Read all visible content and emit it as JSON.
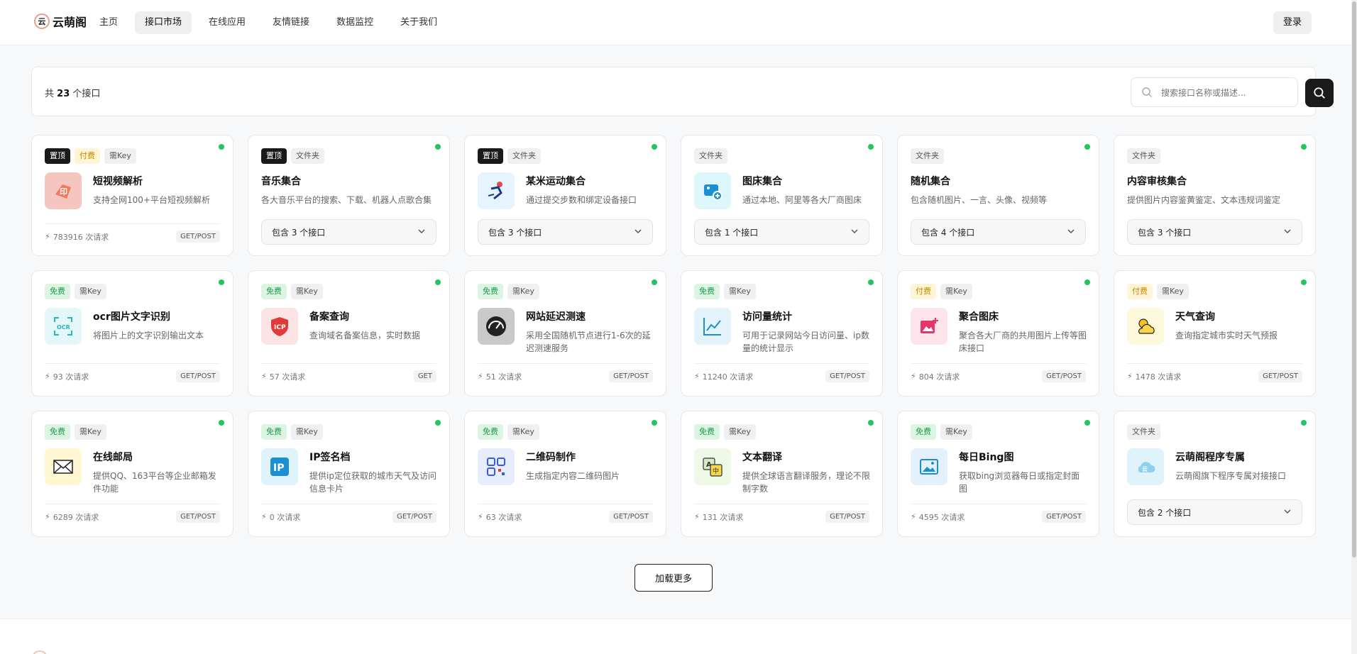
{
  "nav": {
    "logo_text": "云萌阁",
    "logo_sub": "",
    "menu": [
      {
        "label": "主页",
        "active": false
      },
      {
        "label": "接口市场",
        "active": true
      },
      {
        "label": "在线应用",
        "active": false
      },
      {
        "label": "友情链接",
        "active": false
      },
      {
        "label": "数据监控",
        "active": false
      },
      {
        "label": "关于我们",
        "active": false
      }
    ],
    "login_label": "登录"
  },
  "summary": {
    "prefix": "共",
    "count": "23",
    "suffix": "个接口",
    "search_placeholder": "搜索接口名称或描述..."
  },
  "cards": [
    {
      "tags": [
        {
          "text": "置顶",
          "type": "top"
        },
        {
          "text": "付费",
          "type": "paid"
        },
        {
          "text": "需Key",
          "type": "key"
        }
      ],
      "icon": "video-parse-icon",
      "title": "短视频解析",
      "desc": "支持全网100+平台短视频解析",
      "requests": "783916 次请求",
      "method": "GET/POST"
    },
    {
      "tags": [
        {
          "text": "置顶",
          "type": "top"
        },
        {
          "text": "文件夹",
          "type": "key"
        }
      ],
      "title": "音乐集合",
      "desc": "各大音乐平台的搜索、下载、机器人点歌合集",
      "contains": "包含 3 个接口"
    },
    {
      "tags": [
        {
          "text": "置顶",
          "type": "top"
        },
        {
          "text": "文件夹",
          "type": "key"
        }
      ],
      "icon": "sport-icon",
      "title": "某米运动集合",
      "desc": "通过提交步数和绑定设备接口",
      "contains": "包含 3 个接口"
    },
    {
      "tags": [
        {
          "text": "文件夹",
          "type": "key"
        }
      ],
      "icon": "image-upload-icon",
      "title": "图床集合",
      "desc": "通过本地、阿里等各大厂商图床",
      "contains": "包含 1 个接口"
    },
    {
      "tags": [
        {
          "text": "文件夹",
          "type": "key"
        }
      ],
      "title": "随机集合",
      "desc": "包含随机图片、一言、头像、视频等",
      "contains": "包含 4 个接口"
    },
    {
      "tags": [
        {
          "text": "文件夹",
          "type": "key"
        }
      ],
      "title": "内容审核集合",
      "desc": "提供图片内容鉴黄鉴定、文本违规词鉴定",
      "contains": "包含 3 个接口"
    },
    {
      "tags": [
        {
          "text": "免费",
          "type": "free"
        },
        {
          "text": "需Key",
          "type": "key"
        }
      ],
      "icon": "ocr-icon",
      "title": "ocr图片文字识别",
      "desc": "将图片上的文字识别输出文本",
      "requests": "93 次请求",
      "method": "GET/POST"
    },
    {
      "tags": [
        {
          "text": "免费",
          "type": "free"
        },
        {
          "text": "需Key",
          "type": "key"
        }
      ],
      "icon": "icp-icon",
      "title": "备案查询",
      "desc": "查询域名备案信息，实时数据",
      "requests": "57 次请求",
      "method": "GET"
    },
    {
      "tags": [
        {
          "text": "免费",
          "type": "free"
        },
        {
          "text": "需Key",
          "type": "key"
        }
      ],
      "icon": "speedometer-icon",
      "title": "网站延迟测速",
      "desc": "采用全国随机节点进行1-6次的延迟测速服务",
      "requests": "51 次请求",
      "method": "GET/POST"
    },
    {
      "tags": [
        {
          "text": "免费",
          "type": "free"
        },
        {
          "text": "需Key",
          "type": "key"
        }
      ],
      "icon": "line-chart-icon",
      "title": "访问量统计",
      "desc": "可用于记录网站今日访问量、ip数量的统计显示",
      "requests": "11240 次请求",
      "method": "GET/POST"
    },
    {
      "tags": [
        {
          "text": "付费",
          "type": "paid"
        },
        {
          "text": "需Key",
          "type": "key"
        }
      ],
      "icon": "image-add-icon",
      "title": "聚合图床",
      "desc": "聚合各大厂商的共用图片上传等图床接口",
      "requests": "804 次请求",
      "method": "GET/POST"
    },
    {
      "tags": [
        {
          "text": "付费",
          "type": "paid"
        },
        {
          "text": "需Key",
          "type": "key"
        }
      ],
      "icon": "weather-icon",
      "title": "天气查询",
      "desc": "查询指定城市实时天气预报",
      "requests": "1478 次请求",
      "method": "GET/POST"
    },
    {
      "tags": [
        {
          "text": "免费",
          "type": "free"
        },
        {
          "text": "需Key",
          "type": "key"
        }
      ],
      "icon": "mail-icon",
      "title": "在线邮局",
      "desc": "提供QQ、163平台等企业邮箱发件功能",
      "requests": "6289 次请求",
      "method": "GET/POST"
    },
    {
      "tags": [
        {
          "text": "免费",
          "type": "free"
        },
        {
          "text": "需Key",
          "type": "key"
        }
      ],
      "icon": "ip-icon",
      "title": "IP签名档",
      "desc": "提供ip定位获取的城市天气及访问信息卡片",
      "requests": "0 次请求",
      "method": "GET/POST"
    },
    {
      "tags": [
        {
          "text": "免费",
          "type": "free"
        },
        {
          "text": "需Key",
          "type": "key"
        }
      ],
      "icon": "qrcode-icon",
      "title": "二维码制作",
      "desc": "生成指定内容二维码图片",
      "requests": "63 次请求",
      "method": "GET/POST"
    },
    {
      "tags": [
        {
          "text": "免费",
          "type": "free"
        },
        {
          "text": "需Key",
          "type": "key"
        }
      ],
      "icon": "translate-icon",
      "title": "文本翻译",
      "desc": "提供全球语言翻译服务，理论不限制字数",
      "requests": "131 次请求",
      "method": "GET/POST"
    },
    {
      "tags": [
        {
          "text": "免费",
          "type": "free"
        },
        {
          "text": "需Key",
          "type": "key"
        }
      ],
      "icon": "bing-image-icon",
      "title": "每日Bing图",
      "desc": "获取bing浏览器每日或指定封面图",
      "requests": "4595 次请求",
      "method": "GET/POST"
    },
    {
      "tags": [
        {
          "text": "文件夹",
          "type": "key"
        }
      ],
      "icon": "cloud-app-icon",
      "title": "云萌阁程序专属",
      "desc": "云萌阁旗下程序专属对接接口",
      "contains": "包含 2 个接口"
    }
  ],
  "load_more_label": "加载更多"
}
